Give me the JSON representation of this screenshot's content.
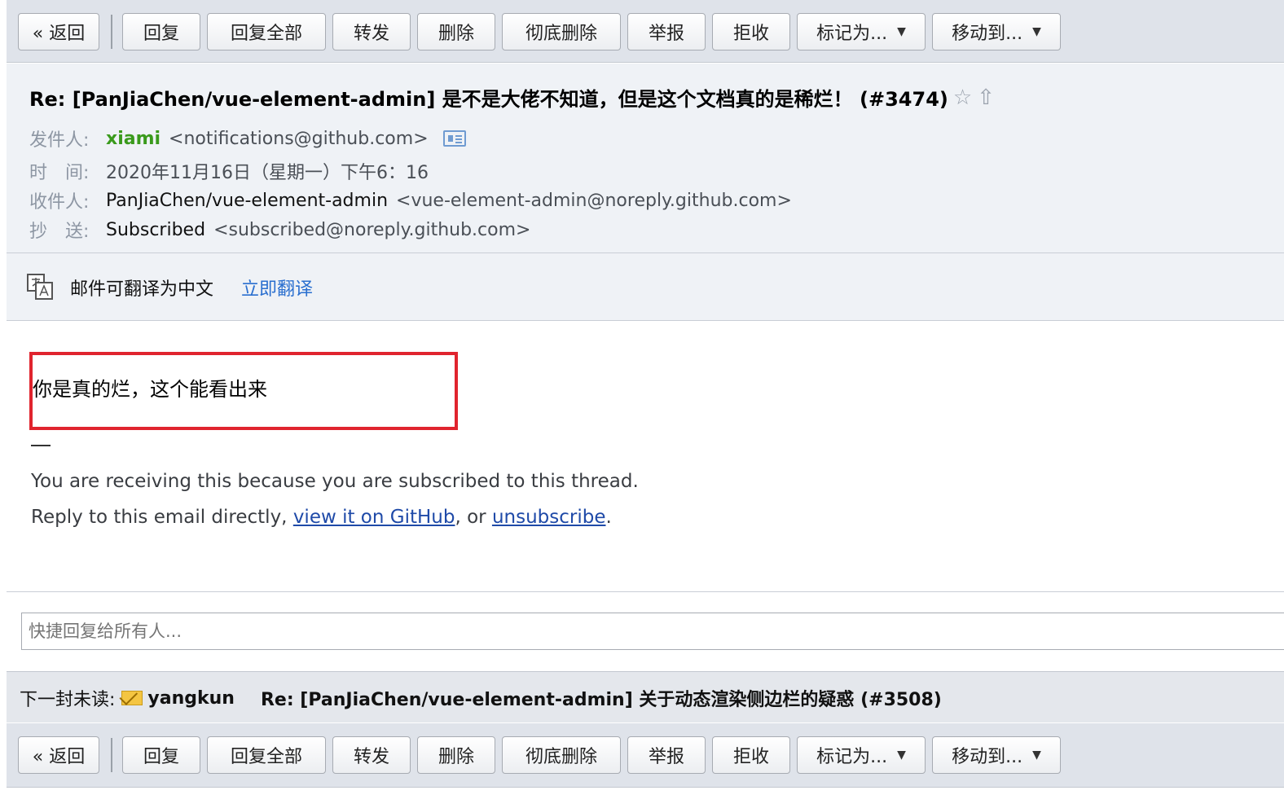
{
  "toolbar": {
    "back": "« 返回",
    "reply": "回复",
    "reply_all": "回复全部",
    "forward": "转发",
    "delete": "删除",
    "delete_forever": "彻底删除",
    "report": "举报",
    "reject": "拒收",
    "mark_as": "标记为...",
    "move_to": "移动到..."
  },
  "email": {
    "subject": "Re: [PanJiaChen/vue-element-admin] 是不是大佬不知道，但是这个文档真的是稀烂！ (#3474)",
    "from_label": "发件人:",
    "from_name": "xiami",
    "from_email": "<notifications@github.com>",
    "time_label": "时　间:",
    "time_value": "2020年11月16日（星期一）下午6：16",
    "to_label": "收件人:",
    "to_name": "PanJiaChen/vue-element-admin",
    "to_email": "<vue-element-admin@noreply.github.com>",
    "cc_label": "抄　送:",
    "cc_name": "Subscribed",
    "cc_email": "<subscribed@noreply.github.com>"
  },
  "translate": {
    "text": "邮件可翻译为中文",
    "link": "立即翻译"
  },
  "body": {
    "message": "你是真的烂，这个能看出来",
    "footer_line1": "You are receiving this because you are subscribed to this thread.",
    "footer_prefix": "Reply to this email directly, ",
    "footer_link1": "view it on GitHub",
    "footer_mid": ", or ",
    "footer_link2": "unsubscribe",
    "footer_end": "."
  },
  "quick_reply": {
    "placeholder": "快捷回复给所有人..."
  },
  "next_unread": {
    "label": "下一封未读:",
    "from": "yangkun",
    "subject": "Re: [PanJiaChen/vue-element-admin] 关于动态渲染侧边栏的疑惑 (#3508)"
  },
  "icons": [
    "star-icon",
    "share-icon",
    "vcard-icon",
    "translate-icon",
    "envelope-icon",
    "dropdown-arrow-icon"
  ],
  "colors": {
    "toolbar_bg": "#dfe3ea",
    "header_bg": "#eff2f6",
    "link": "#2a6fcf",
    "sender_green": "#3a9a1c",
    "highlight_red": "#e0242e"
  }
}
